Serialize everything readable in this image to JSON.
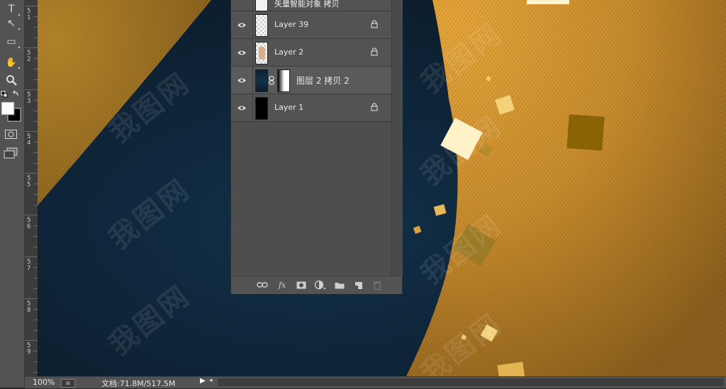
{
  "toolbar": {
    "tools": [
      {
        "icon": "type-tool-icon",
        "glyph": "T"
      },
      {
        "icon": "path-select-tool-icon",
        "glyph": "↖"
      },
      {
        "icon": "rectangle-tool-icon",
        "glyph": "▭"
      },
      {
        "icon": "hand-tool-icon",
        "glyph": "✋"
      },
      {
        "icon": "zoom-tool-icon",
        "glyph": "🔍"
      }
    ],
    "foreground_color": "#ffffff",
    "background_color": "#000000"
  },
  "ruler": {
    "labels": [
      "1",
      "2",
      "3",
      "4",
      "5",
      "6",
      "7",
      "8",
      "9"
    ],
    "prefix_digit": "5"
  },
  "layers_panel": {
    "partial_top_layer": "矢量智能对象 拷贝",
    "layers": [
      {
        "name": "Layer 39",
        "visible": true,
        "locked": true,
        "thumb": "transparent"
      },
      {
        "name": "Layer 2",
        "visible": true,
        "locked": true,
        "thumb": "figure"
      },
      {
        "name": "图层 2 拷贝 2",
        "visible": true,
        "locked": false,
        "thumb": "dark-with-mask"
      },
      {
        "name": "Layer 1",
        "visible": true,
        "locked": true,
        "thumb": "black"
      }
    ],
    "bottom_icons": [
      "link-layers-icon",
      "fx-icon",
      "add-mask-icon",
      "adjustment-layer-icon",
      "new-group-icon",
      "new-layer-icon",
      "trash-icon"
    ],
    "fx_label": "fx"
  },
  "status": {
    "zoom": "100%",
    "doc_info": "文档:71.8M/517.5M"
  },
  "watermark": "我图网",
  "colors": {
    "canvas_bg": "#0f2436",
    "gold": "#c98f2b",
    "panel_bg": "#535353"
  }
}
